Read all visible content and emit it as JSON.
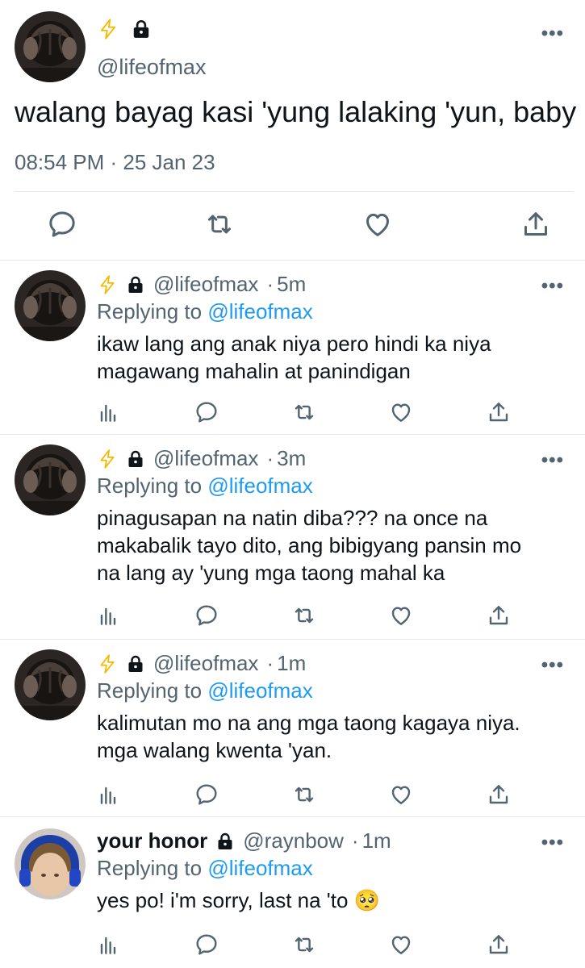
{
  "main_tweet": {
    "handle": "@lifeofmax",
    "text": "walang bayag kasi 'yung lalaking 'yun, baby",
    "timestamp": "08:54 PM · 25 Jan 23",
    "more": "•••"
  },
  "replies": [
    {
      "name": "",
      "handle": "@lifeofmax",
      "sep": "·",
      "time": "5m",
      "replying_prefix": "Replying to",
      "replying_to": "@lifeofmax",
      "lines": [
        "ikaw lang ang anak niya pero hindi ka niya",
        "magawang mahalin at panindigan"
      ],
      "more": "•••"
    },
    {
      "name": "",
      "handle": "@lifeofmax",
      "sep": "·",
      "time": "3m",
      "replying_prefix": "Replying to",
      "replying_to": "@lifeofmax",
      "lines": [
        "pinagusapan na natin diba??? na once na",
        "makabalik tayo dito, ang bibigyang pansin mo",
        "na lang ay 'yung mga taong mahal ka"
      ],
      "more": "•••"
    },
    {
      "name": "",
      "handle": "@lifeofmax",
      "sep": "·",
      "time": "1m",
      "replying_prefix": "Replying to",
      "replying_to": "@lifeofmax",
      "lines": [
        "kalimutan mo na ang mga taong kagaya niya.",
        "mga walang kwenta 'yan."
      ],
      "more": "•••"
    },
    {
      "name": "your honor",
      "handle": "@raynbow",
      "sep": "·",
      "time": "1m",
      "replying_prefix": "Replying to",
      "replying_to": "@lifeofmax",
      "lines": [
        "yes po! i'm sorry, last na 'to 🥺"
      ],
      "more": "•••"
    }
  ],
  "colors": {
    "text": "#0f1419",
    "muted": "#536471",
    "link": "#1d9bf0",
    "lightning": "#f5b800",
    "divider": "#e6e9eb"
  },
  "icons": [
    "lightning-icon",
    "lock-icon",
    "reply-icon",
    "retweet-icon",
    "like-icon",
    "share-icon",
    "analytics-icon",
    "more-icon"
  ]
}
